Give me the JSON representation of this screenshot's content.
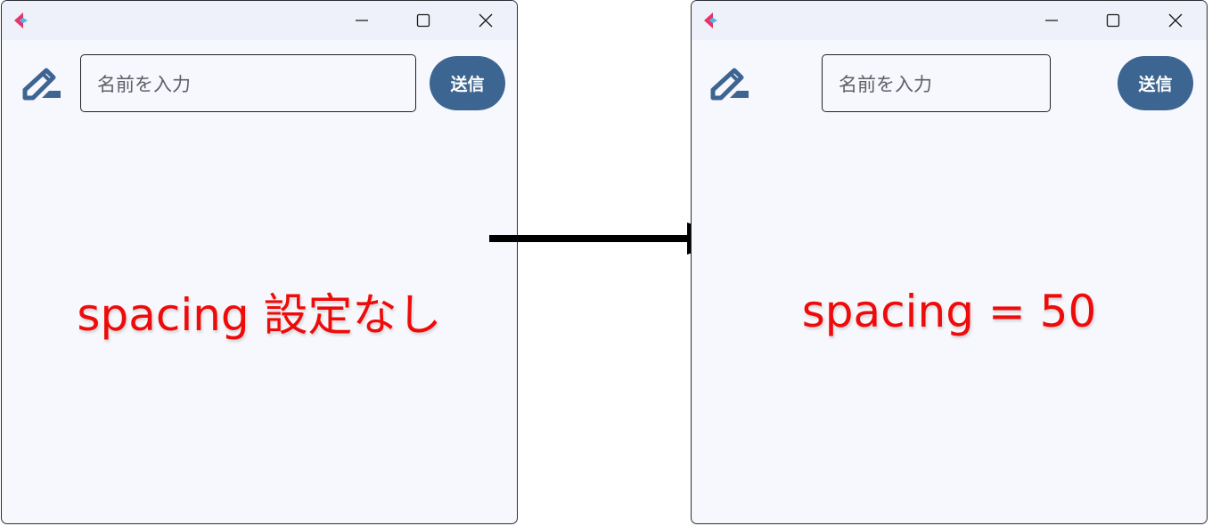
{
  "input_placeholder": "名前を入力",
  "send_label": "送信",
  "left_caption": "spacing 設定なし",
  "right_caption": "spacing = 50",
  "colors": {
    "accent": "#3d6592",
    "caption": "#ee0b0b",
    "window_bg": "#f7f8fd",
    "titlebar_bg": "#eef1f9"
  },
  "icons": {
    "app_logo": "flutter-logo-icon",
    "leading": "pencil-icon",
    "window_controls": [
      "minimize-icon",
      "maximize-icon",
      "close-icon"
    ],
    "connector": "arrow-right-icon"
  }
}
